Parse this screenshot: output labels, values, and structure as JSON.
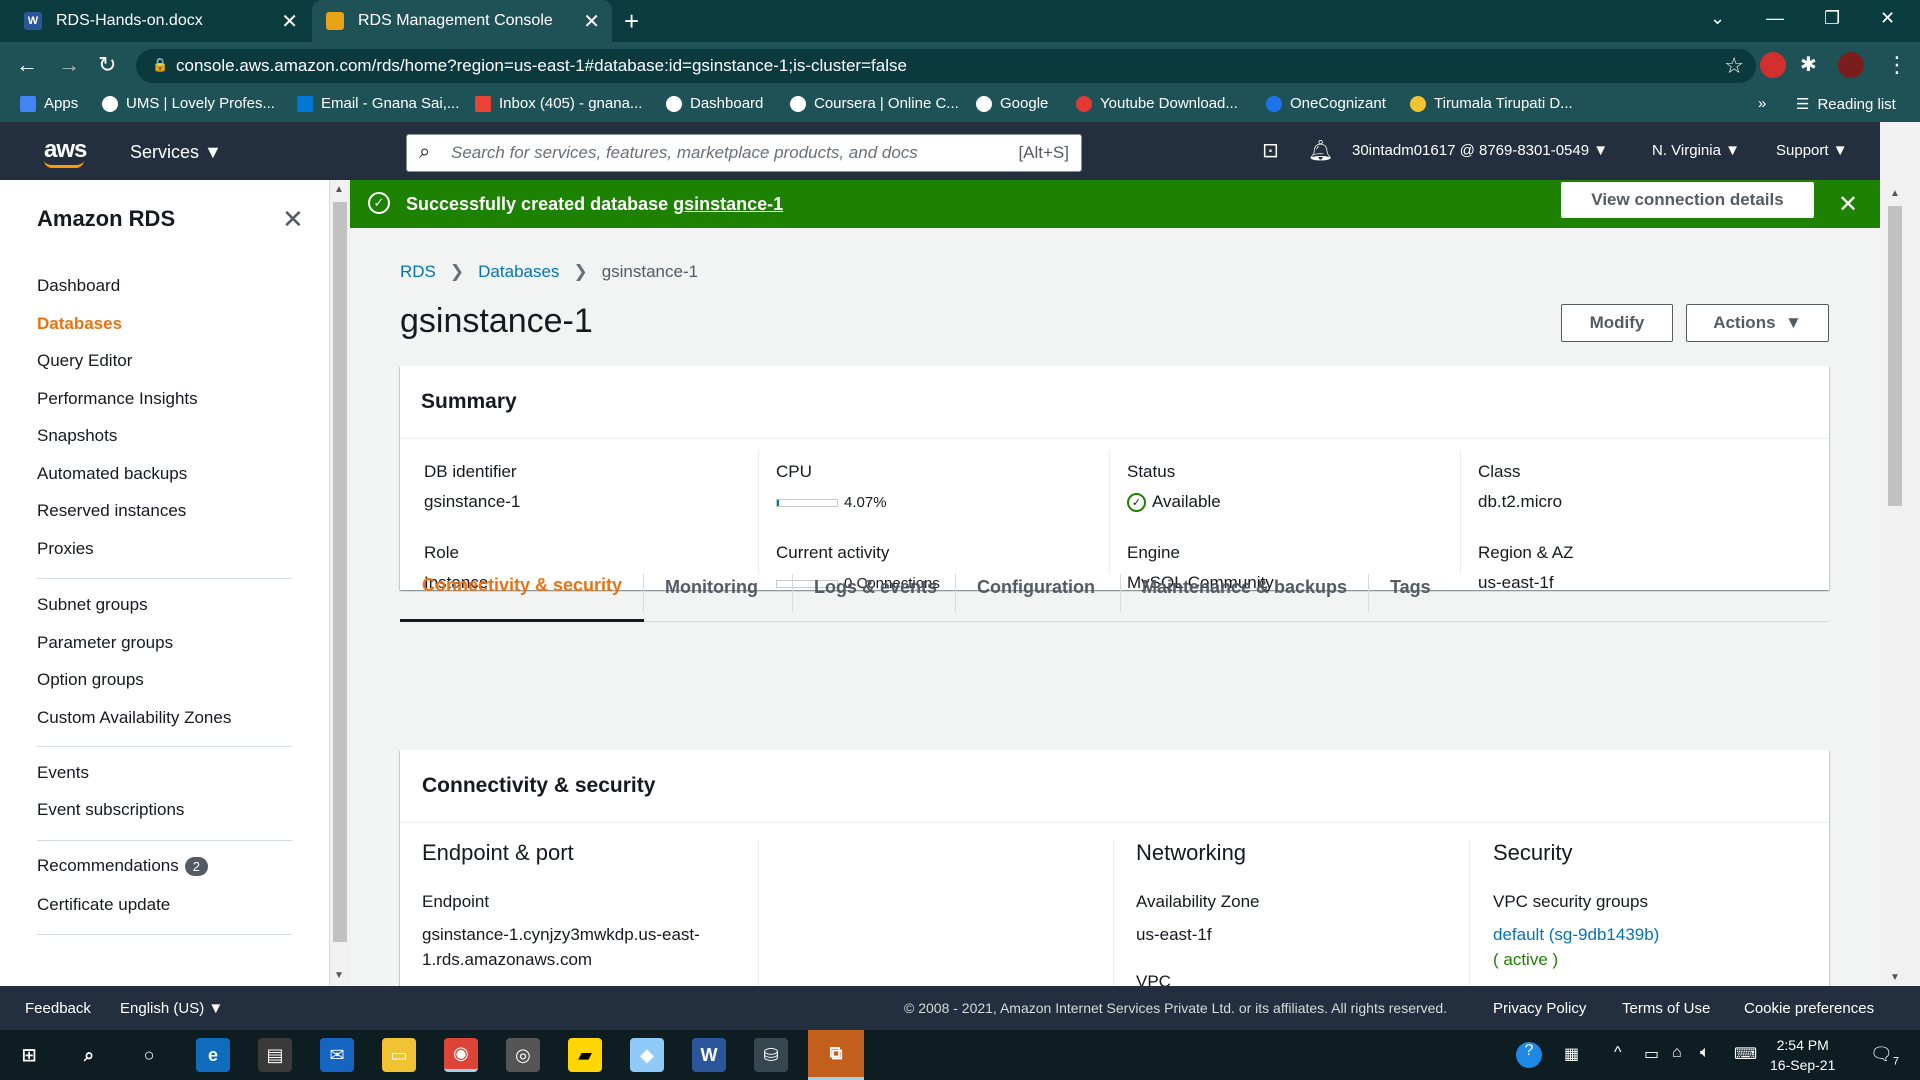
{
  "browser": {
    "tabs": [
      {
        "title": "RDS-Hands-on.docx",
        "icon": "word-icon"
      },
      {
        "title": "RDS Management Console",
        "icon": "aws-box-icon"
      }
    ],
    "url": "console.aws.amazon.com/rds/home?region=us-east-1#database:id=gsinstance-1;is-cluster=false",
    "bookmarks": [
      "Apps",
      "UMS | Lovely Profes...",
      "Email - Gnana Sai,...",
      "Inbox (405) - gnana...",
      "Dashboard",
      "Coursera | Online C...",
      "Google",
      "Youtube Download...",
      "OneCognizant",
      "Tirumala Tirupati D..."
    ],
    "reading_list": "Reading list",
    "overflow": "»"
  },
  "aws_header": {
    "logo": "aws",
    "services": "Services",
    "search_placeholder": "Search for services, features, marketplace products, and docs",
    "search_shortcut": "[Alt+S]",
    "account": "30intadm01617 @ 8769-8301-0549",
    "region": "N. Virginia",
    "support": "Support"
  },
  "sidebar": {
    "title": "Amazon RDS",
    "group1": [
      "Dashboard",
      "Databases",
      "Query Editor",
      "Performance Insights",
      "Snapshots",
      "Automated backups",
      "Reserved instances",
      "Proxies"
    ],
    "group2": [
      "Subnet groups",
      "Parameter groups",
      "Option groups",
      "Custom Availability Zones"
    ],
    "group3": [
      "Events",
      "Event subscriptions"
    ],
    "group4": [
      "Recommendations",
      "Certificate update"
    ],
    "recommendations_count": "2",
    "active": "Databases"
  },
  "flash": {
    "message": "Successfully created database",
    "db_link": "gsinstance-1",
    "button": "View connection details"
  },
  "breadcrumb": [
    "RDS",
    "Databases",
    "gsinstance-1"
  ],
  "page_title": "gsinstance-1",
  "buttons": {
    "modify": "Modify",
    "actions": "Actions"
  },
  "summary": {
    "title": "Summary",
    "db_identifier_label": "DB identifier",
    "db_identifier": "gsinstance-1",
    "role_label": "Role",
    "role": "Instance",
    "cpu_label": "CPU",
    "cpu": "4.07%",
    "cpu_fraction": 0.0407,
    "activity_label": "Current activity",
    "activity": "0 Connections",
    "status_label": "Status",
    "status": "Available",
    "engine_label": "Engine",
    "engine": "MySQL Community",
    "class_label": "Class",
    "class": "db.t2.micro",
    "region_label": "Region & AZ",
    "region": "us-east-1f"
  },
  "detail_tabs": [
    "Connectivity & security",
    "Monitoring",
    "Logs & events",
    "Configuration",
    "Maintenance & backups",
    "Tags"
  ],
  "connectivity": {
    "title": "Connectivity & security",
    "endpoint_heading": "Endpoint & port",
    "endpoint_label": "Endpoint",
    "endpoint_line1": "gsinstance-1.cynjzy3mwkdp.us-east-",
    "endpoint_line2": "1.rds.amazonaws.com",
    "networking_heading": "Networking",
    "az_label": "Availability Zone",
    "az": "us-east-1f",
    "vpc_label": "VPC",
    "security_heading": "Security",
    "vpc_sg_label": "VPC security groups",
    "vpc_sg": "default (sg-9db1439b)",
    "vpc_sg_status": "( active )"
  },
  "footer": {
    "feedback": "Feedback",
    "language": "English (US)",
    "copyright": "© 2008 - 2021, Amazon Internet Services Private Ltd. or its affiliates. All rights reserved.",
    "privacy": "Privacy Policy",
    "terms": "Terms of Use",
    "cookies": "Cookie preferences"
  },
  "taskbar": {
    "time": "2:54 PM",
    "date": "16-Sep-21",
    "notifications": "7"
  },
  "colors": {
    "aws_orange": "#ec7211",
    "success_green": "#1d8102",
    "link_blue": "#0073bb",
    "aws_navy": "#232f3e",
    "chrome_teal": "#1f5257"
  }
}
